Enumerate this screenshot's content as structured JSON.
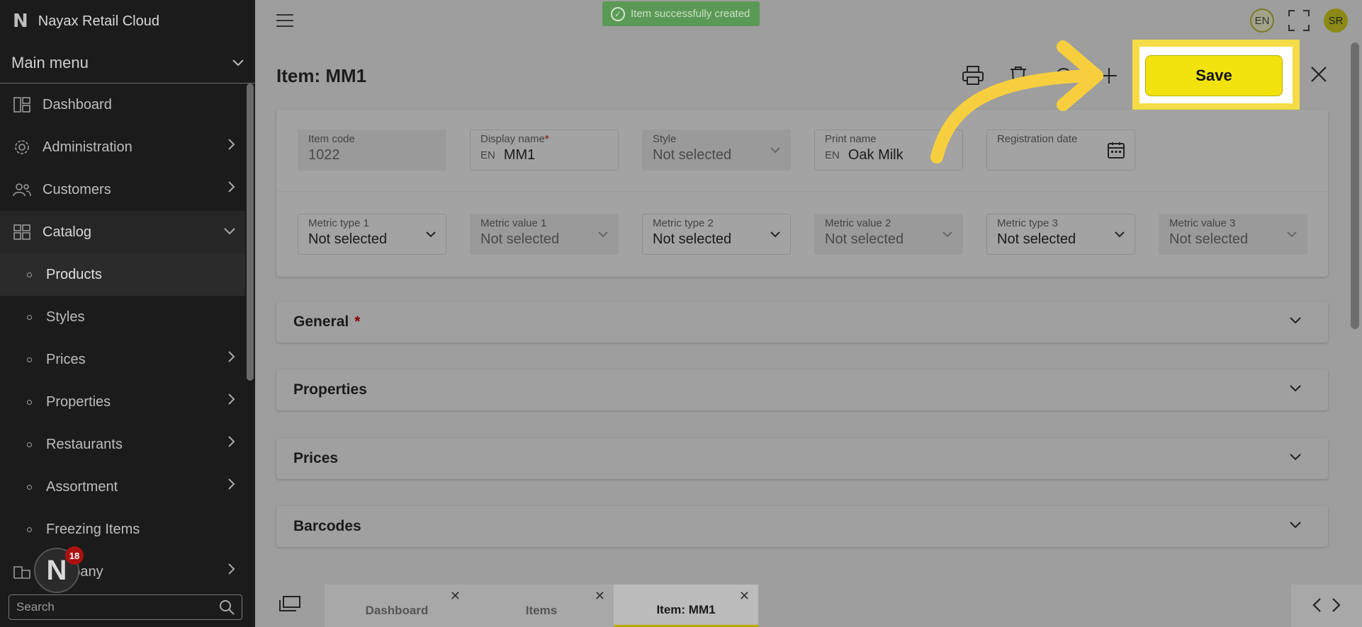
{
  "brand": {
    "name": "Nayax Retail Cloud",
    "logo_letter": "N"
  },
  "sidebar": {
    "main_menu_label": "Main menu",
    "items": [
      {
        "label": "Dashboard",
        "icon": "dashboard-icon",
        "has_chevron": false
      },
      {
        "label": "Administration",
        "icon": "gear-icon",
        "has_chevron": true
      },
      {
        "label": "Customers",
        "icon": "users-icon",
        "has_chevron": true
      },
      {
        "label": "Catalog",
        "icon": "catalog-icon",
        "has_chevron": true,
        "expanded": true
      }
    ],
    "sub_items": [
      {
        "label": "Products",
        "active": true,
        "has_chevron": false
      },
      {
        "label": "Styles",
        "has_chevron": false
      },
      {
        "label": "Prices",
        "has_chevron": true
      },
      {
        "label": "Properties",
        "has_chevron": true
      },
      {
        "label": "Restaurants",
        "has_chevron": true
      },
      {
        "label": "Assortment",
        "has_chevron": true
      },
      {
        "label": "Freezing Items",
        "has_chevron": false
      }
    ],
    "partial_item": "Company",
    "search_placeholder": "Search",
    "notification_count": "18"
  },
  "topbar": {
    "toast": "Item successfully created",
    "language": "EN",
    "user_initials": "SR"
  },
  "page": {
    "title": "Item: MM1",
    "save_label": "Save"
  },
  "form": {
    "row1": [
      {
        "label": "Item code",
        "value": "1022",
        "disabled": true
      },
      {
        "label": "Display name",
        "required": true,
        "prefix": "EN",
        "value": "MM1"
      },
      {
        "label": "Style",
        "value": "Not selected",
        "disabled": true,
        "dropdown": true
      },
      {
        "label": "Print name",
        "prefix": "EN",
        "value": "Oak Milk"
      },
      {
        "label": "Registration date",
        "value": "",
        "calendar": true
      }
    ],
    "row2": [
      {
        "label": "Metric type 1",
        "value": "Not selected",
        "dropdown": true
      },
      {
        "label": "Metric value 1",
        "value": "Not selected",
        "disabled": true,
        "dropdown": true
      },
      {
        "label": "Metric type 2",
        "value": "Not selected",
        "dropdown": true
      },
      {
        "label": "Metric value 2",
        "value": "Not selected",
        "disabled": true,
        "dropdown": true
      },
      {
        "label": "Metric type 3",
        "value": "Not selected",
        "dropdown": true
      },
      {
        "label": "Metric value 3",
        "value": "Not selected",
        "disabled": true,
        "dropdown": true
      }
    ]
  },
  "sections": [
    {
      "label": "General",
      "required": true
    },
    {
      "label": "Properties",
      "required": false
    },
    {
      "label": "Prices",
      "required": false
    },
    {
      "label": "Barcodes",
      "required": false
    }
  ],
  "tabs": [
    {
      "label": "Dashboard",
      "active": false
    },
    {
      "label": "Items",
      "active": false
    },
    {
      "label": "Item: MM1",
      "active": true
    }
  ],
  "colors": {
    "highlight": "#f6dc46",
    "save_bg": "#f2e20e",
    "toast_bg": "#5b9a56"
  }
}
